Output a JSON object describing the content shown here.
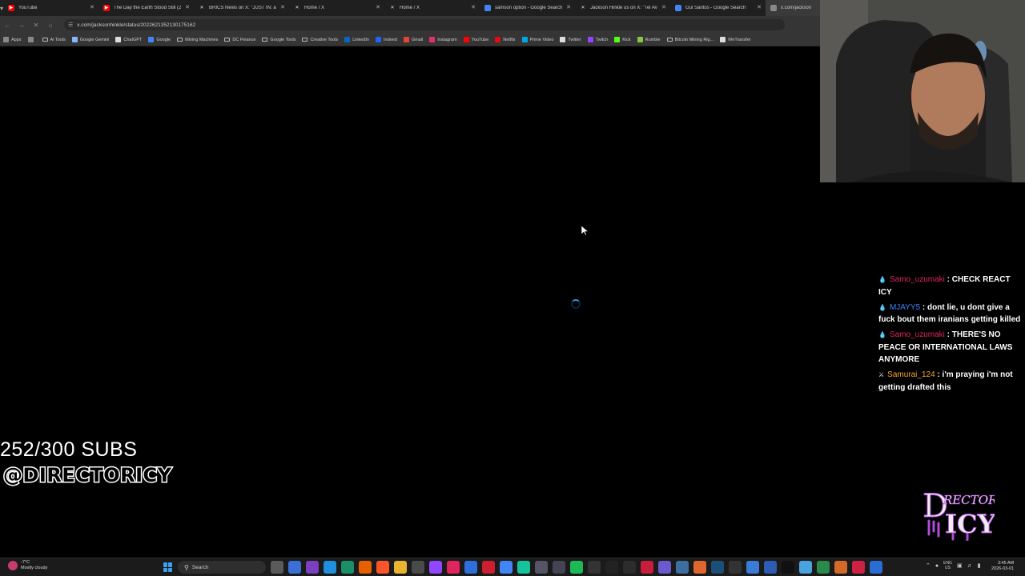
{
  "browser": {
    "tabs": [
      {
        "label": "YouTube",
        "icon": "youtube-icon",
        "color": "#ff0000"
      },
      {
        "label": "The Day the Earth Stood Still (2",
        "icon": "youtube-icon",
        "color": "#ff0000"
      },
      {
        "label": "BRICS News on X: \"JUST IN: ac",
        "icon": "x-icon",
        "color": "#000000"
      },
      {
        "label": "Home / X",
        "icon": "x-icon",
        "color": "#000000"
      },
      {
        "label": "Home / X",
        "icon": "x-icon",
        "color": "#000000"
      },
      {
        "label": "samson option - Google Search",
        "icon": "google-icon",
        "color": "#4285f4"
      },
      {
        "label": "Jackson Hinkle us on X: \"Tel Av",
        "icon": "x-icon",
        "color": "#000000"
      },
      {
        "label": "Gui Santos - Google Search",
        "icon": "google-icon",
        "color": "#4285f4"
      },
      {
        "label": "x.com/jackson",
        "icon": "loading-icon",
        "color": "#888888"
      }
    ],
    "url": "x.com/jacksonhinkle/status/2022621352130175162",
    "bookmarks": [
      {
        "label": "Apps",
        "icon": "apps-grid-icon"
      },
      {
        "label": "",
        "icon": "tab-groups-icon"
      },
      {
        "label": "Ai Tools",
        "icon": "folder-icon"
      },
      {
        "label": "Google Gemini",
        "icon": "gemini-icon"
      },
      {
        "label": "ChatGPT",
        "icon": "chatgpt-icon"
      },
      {
        "label": "Google",
        "icon": "google-icon"
      },
      {
        "label": "Mining Machines",
        "icon": "folder-icon"
      },
      {
        "label": "DC Finance",
        "icon": "folder-icon"
      },
      {
        "label": "Google Tools",
        "icon": "folder-icon"
      },
      {
        "label": "Creative Tools",
        "icon": "folder-icon"
      },
      {
        "label": "LinkedIn",
        "icon": "linkedin-icon"
      },
      {
        "label": "Indeed",
        "icon": "indeed-icon"
      },
      {
        "label": "Gmail",
        "icon": "gmail-icon"
      },
      {
        "label": "Instagram",
        "icon": "instagram-icon"
      },
      {
        "label": "YouTube",
        "icon": "youtube-icon"
      },
      {
        "label": "Netflix",
        "icon": "netflix-icon"
      },
      {
        "label": "Prime Video",
        "icon": "prime-video-icon"
      },
      {
        "label": "Twitter",
        "icon": "x-icon"
      },
      {
        "label": "Twitch",
        "icon": "twitch-icon"
      },
      {
        "label": "Kick",
        "icon": "kick-icon"
      },
      {
        "label": "Rumble",
        "icon": "rumble-icon"
      },
      {
        "label": "Bitcoin Mining Rig...",
        "icon": "folder-icon"
      },
      {
        "label": "WeTransfer",
        "icon": "wetransfer-icon"
      }
    ]
  },
  "chat": {
    "messages": [
      {
        "badge": "water-drop-icon",
        "user": "Samo_uzumaki",
        "user_color": "#e0245e",
        "text": ": CHECK REACT ICY"
      },
      {
        "badge": "water-drop-icon",
        "user": "MJAYY5",
        "user_color": "#3b82f6",
        "text": ": dont lie, u dont give a fuck bout them iranians getting killed"
      },
      {
        "badge": "water-drop-icon",
        "user": "Samo_uzumaki",
        "user_color": "#e0245e",
        "text": ": THERE'S NO PEACE OR INTERNATIONAL LAWS ANYMORE"
      },
      {
        "badge": "sword-crown-icon",
        "user": "Samurai_124",
        "user_color": "#f5a623",
        "text": ": i'm praying i'm not getting drafted this"
      }
    ]
  },
  "overlay": {
    "subs": "252/300 SUBS",
    "handle": "@DIRECTORICY",
    "logo_text_top": "RECTOR",
    "logo_text_bottom": "ICY",
    "logo_letter": "D"
  },
  "taskbar": {
    "weather_temp": "-7°C",
    "weather_desc": "Mostly cloudy",
    "search_placeholder": "Search",
    "lang_line1": "ENG",
    "lang_line2": "US",
    "time": "3:45 AM",
    "date": "2026-03-01",
    "apps": [
      {
        "icon": "task-view-icon",
        "color": "#5a5a5a"
      },
      {
        "icon": "copilot-icon",
        "color": "#3b6fd8"
      },
      {
        "icon": "photos-icon",
        "color": "#7b3fbf"
      },
      {
        "icon": "explorer-icon",
        "color": "#1f8fde"
      },
      {
        "icon": "edge-icon",
        "color": "#1a8f6a"
      },
      {
        "icon": "firefox-icon",
        "color": "#e66000"
      },
      {
        "icon": "brave-icon",
        "color": "#fb542b"
      },
      {
        "icon": "folder-icon",
        "color": "#e8b32f"
      },
      {
        "icon": "obs-icon",
        "color": "#4a4a4a"
      },
      {
        "icon": "twitch-icon",
        "color": "#9146ff"
      },
      {
        "icon": "app-icon",
        "color": "#e0245e"
      },
      {
        "icon": "chrome-icon",
        "color": "#2f6fdd"
      },
      {
        "icon": "opera-icon",
        "color": "#cc1f2f"
      },
      {
        "icon": "chrome-active-icon",
        "color": "#4285f4"
      },
      {
        "icon": "grammarly-icon",
        "color": "#15c39a"
      },
      {
        "icon": "app-icon",
        "color": "#556"
      },
      {
        "icon": "app-icon",
        "color": "#445"
      },
      {
        "icon": "spotify-icon",
        "color": "#1db954"
      },
      {
        "icon": "app-icon",
        "color": "#333"
      },
      {
        "icon": "capcut-icon",
        "color": "#222"
      },
      {
        "icon": "app-icon",
        "color": "#2c2c2c"
      },
      {
        "icon": "app-icon",
        "color": "#c81e3c"
      },
      {
        "icon": "app-icon",
        "color": "#6a5acd"
      },
      {
        "icon": "app-icon",
        "color": "#3c6e9e"
      },
      {
        "icon": "app-icon",
        "color": "#e0662f"
      },
      {
        "icon": "steam-icon",
        "color": "#1b4f7a"
      },
      {
        "icon": "app-icon",
        "color": "#333"
      },
      {
        "icon": "app-icon",
        "color": "#3a7bd5"
      },
      {
        "icon": "app-icon",
        "color": "#2d5db3"
      },
      {
        "icon": "x-icon",
        "color": "#111"
      },
      {
        "icon": "app-icon",
        "color": "#4aa3df"
      },
      {
        "icon": "app-icon",
        "color": "#2a8a4a"
      },
      {
        "icon": "app-icon",
        "color": "#d46a2a"
      },
      {
        "icon": "app-icon",
        "color": "#cc2244"
      },
      {
        "icon": "app-icon",
        "color": "#2a6cd4"
      }
    ]
  }
}
